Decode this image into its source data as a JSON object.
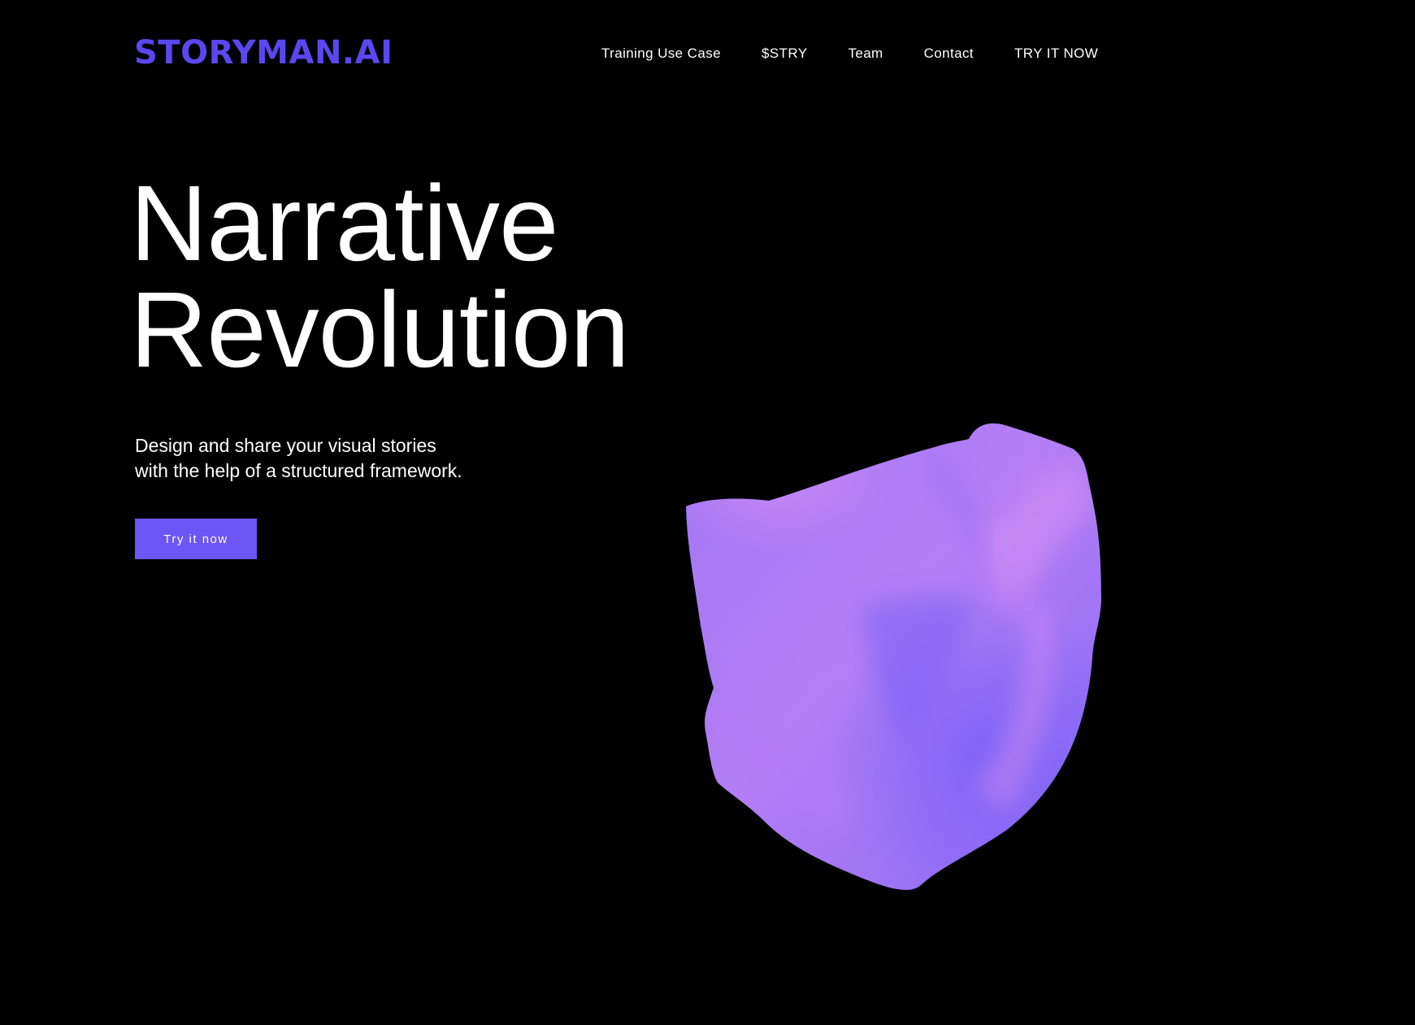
{
  "header": {
    "logo": "STORYMAN.AI",
    "nav": [
      "Training Use Case",
      "$STRY",
      "Team",
      "Contact",
      "TRY IT NOW"
    ]
  },
  "hero": {
    "title_lines": [
      "Narrative",
      "Revolution"
    ],
    "subtitle_lines": [
      "Design and share your visual stories",
      "with the help of a structured framework."
    ],
    "cta_label": "Try it now"
  },
  "graphic": {
    "name": "purple-cloth-blob"
  },
  "colors": {
    "background": "#000000",
    "brand": "#5b47f0",
    "button": "#6c56f5",
    "text": "#ffffff",
    "blob_light": "#c67ff3",
    "blob_dark": "#7f66f6"
  }
}
